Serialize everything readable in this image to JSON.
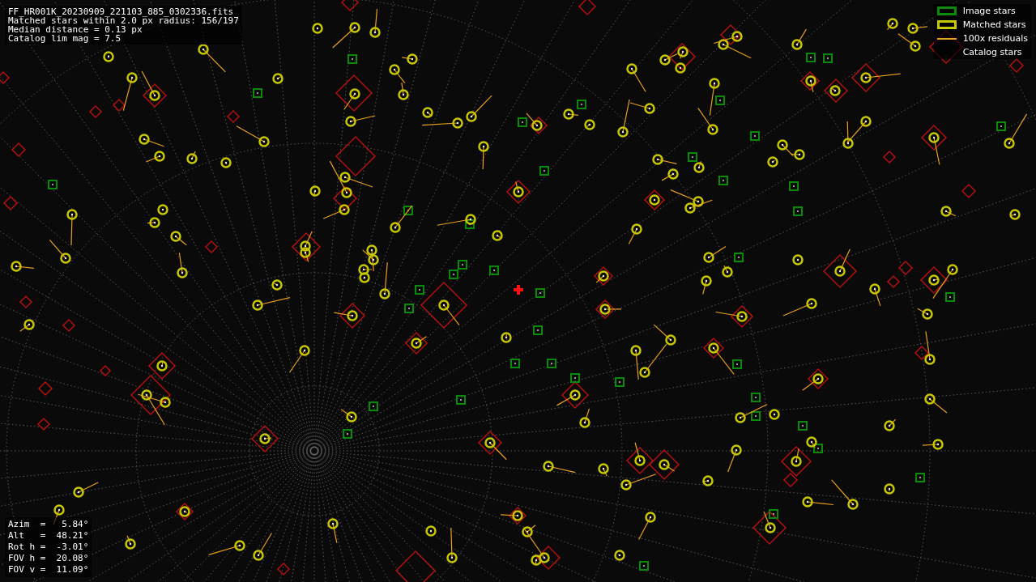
{
  "info_lines": [
    "FF_HR001K_20230909_221103_885_0302336.fits",
    "Matched stars within 2.0 px radius: 156/197",
    "Median distance = 0.13 px",
    "Catalog lim mag = 7.5"
  ],
  "legend": [
    {
      "kind": "image",
      "label": "Image stars"
    },
    {
      "kind": "matched",
      "label": "Matched stars"
    },
    {
      "kind": "residual",
      "label": "100x residuals"
    },
    {
      "kind": "catalog",
      "label": "Catalog stars"
    }
  ],
  "pointing_lines": [
    "Azim  =   5.84°",
    "Alt   =  48.21°",
    "Rot h =  -3.01°",
    "FOV h =  20.08°",
    "FOV v =  11.09°"
  ]
}
